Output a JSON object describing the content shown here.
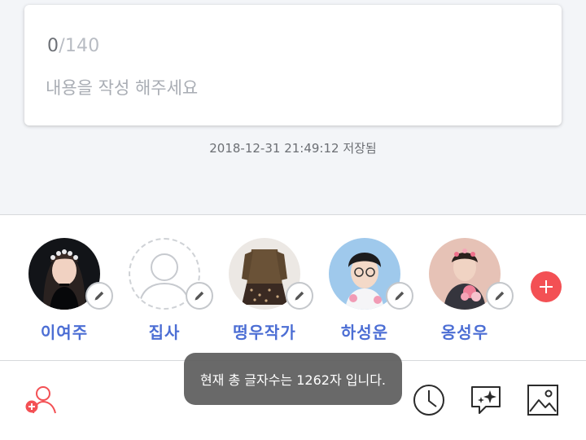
{
  "editor": {
    "char_count": "0",
    "char_limit": "/140",
    "placeholder": "내용을 작성 해주세요",
    "saved_status": "2018-12-31 21:49:12 저장됨"
  },
  "characters": [
    {
      "name": "이여주",
      "avatar": "photo"
    },
    {
      "name": "집사",
      "avatar": "empty-person"
    },
    {
      "name": "떵우작가",
      "avatar": "photo"
    },
    {
      "name": "하성운",
      "avatar": "photo"
    },
    {
      "name": "옹성우",
      "avatar": "photo"
    }
  ],
  "toolbar": {
    "icons": [
      "add-user-icon",
      "clock-icon",
      "ai-sparkle-icon",
      "image-icon"
    ]
  },
  "toast": {
    "message": "현재 총 글자수는 1262자 입니다."
  },
  "colors": {
    "accent_red": "#f35054",
    "name_blue": "#4c6ed4"
  }
}
